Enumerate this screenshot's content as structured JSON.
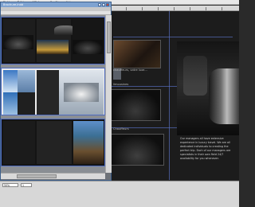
{
  "menubar": {
    "items": [
      "Fichier",
      "Édition",
      "Affichage",
      "Fenêtre",
      "Aide"
    ]
  },
  "window": {
    "title": "Brochure.indd"
  },
  "background_doc": {
    "caption_1": "chauffeurs, votre luxe...",
    "caption_2": "limousines",
    "caption_3": "Chauffeurs",
    "paragraph": "Our managers all have extensive experience in luxury travel. We are all dedicated individuals to creating the perfect trip. Each of our managers are specialists in their own field 24/7 availability for you whenever."
  },
  "status": {
    "zoom": "50%",
    "page": "1"
  }
}
